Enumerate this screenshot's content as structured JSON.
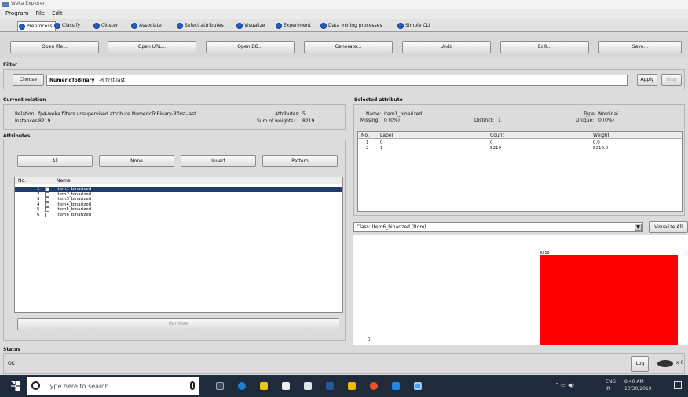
{
  "window": {
    "title": "Weka Explorer"
  },
  "menu": [
    "Program",
    "File",
    "Edit"
  ],
  "tabs": [
    "Preprocess",
    "Classify",
    "Cluster",
    "Associate",
    "Select attributes",
    "Visualize",
    "Experiment",
    "Data mining processes",
    "Simple CLI"
  ],
  "toolbar": [
    "Open file...",
    "Open URL...",
    "Open DB...",
    "Generate...",
    "Undo",
    "Edit...",
    "Save..."
  ],
  "filter": {
    "header": "Filter",
    "choose_label": "Choose",
    "name": "NumericToBinary",
    "options": "-R first-last",
    "apply_label": "Apply",
    "stop_label": "Stop"
  },
  "current_relation": {
    "header": "Current relation",
    "relation_label": "Relation:",
    "relation_value": "fp4-weka.filters.unsupervised.attribute.NumericToBinary-Rfirst-last",
    "instances_label": "Instances:",
    "instances_value": "8219",
    "attributes_label": "Attributes:",
    "attributes_value": "5",
    "sum_weights_label": "Sum of weights:",
    "sum_weights_value": "8219"
  },
  "attributes": {
    "header": "Attributes",
    "buttons": [
      "All",
      "None",
      "Invert",
      "Pattern"
    ],
    "col_no": "No.",
    "col_name": "Name",
    "rows": [
      {
        "no": "1",
        "name": "Item1_binarized"
      },
      {
        "no": "2",
        "name": "Item2_binarized"
      },
      {
        "no": "3",
        "name": "Item3_binarized"
      },
      {
        "no": "4",
        "name": "Item4_binarized"
      },
      {
        "no": "5",
        "name": "Item5_binarized"
      },
      {
        "no": "6",
        "name": "Item6_binarized"
      }
    ],
    "selected_index": 0,
    "remove_label": "Remove"
  },
  "selected_attribute": {
    "header": "Selected attribute",
    "name_label": "Name:",
    "name_value": "Item1_binarized",
    "type_label": "Type:",
    "type_value": "Nominal",
    "missing_label": "Missing:",
    "missing_value": "0 (0%)",
    "distinct_label": "Distinct:",
    "distinct_value": "1",
    "unique_label": "Unique:",
    "unique_value": "0 (0%)",
    "columns": [
      "No.",
      "Label",
      "Count",
      "Weight"
    ],
    "rows": [
      {
        "no": "1",
        "label": "0",
        "count": "0",
        "weight": "0.0"
      },
      {
        "no": "2",
        "label": "1",
        "count": "8219",
        "weight": "8219.0"
      }
    ]
  },
  "class_select": {
    "value": "Class: Item6_binarized (Nom)",
    "visualize_label": "Visualize All"
  },
  "histogram": {
    "bar_label": "8219",
    "zero_label": "0",
    "bar_color": "#ff0000"
  },
  "status": {
    "header": "Status",
    "text": "OK",
    "log_label": "Log",
    "tasks": "x 0"
  },
  "taskbar": {
    "search_placeholder": "Type here to search",
    "time": "8:40 AM",
    "lang": "ENG",
    "region": "IN",
    "date": "10/30/2019"
  },
  "colors": {
    "tab_dot": "#1f5fbf",
    "selected_row": "#1c3d6e",
    "taskbar": "#1f2a3a"
  }
}
